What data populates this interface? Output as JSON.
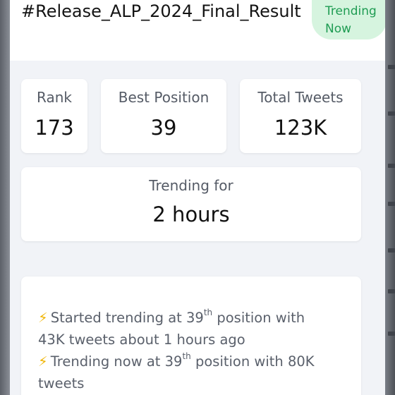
{
  "header": {
    "title": "#Release_ALP_2024_Final_Result",
    "badge_line1": "Trending",
    "badge_line2": "Now"
  },
  "stats": {
    "rank_label": "Rank",
    "rank_value": "173",
    "best_label": "Best Position",
    "best_value": "39",
    "tweets_label": "Total Tweets",
    "tweets_value": "123K"
  },
  "duration": {
    "label": "Trending for",
    "value": "2 hours"
  },
  "events": [
    {
      "icon": "lightning-icon",
      "prefix": "Started trending at 39",
      "sup": "th",
      "rest1": " position with",
      "rest2": "43K tweets about 1 hours ago"
    },
    {
      "icon": "lightning-icon",
      "prefix": "Trending now at 39",
      "sup": "th",
      "rest1": " position with 80K",
      "rest2": "tweets"
    }
  ],
  "colors": {
    "badge_bg": "#d6f4df",
    "badge_text": "#1f9c53",
    "bolt": "#f0b400",
    "panel_bg": "#f1f3f7"
  }
}
